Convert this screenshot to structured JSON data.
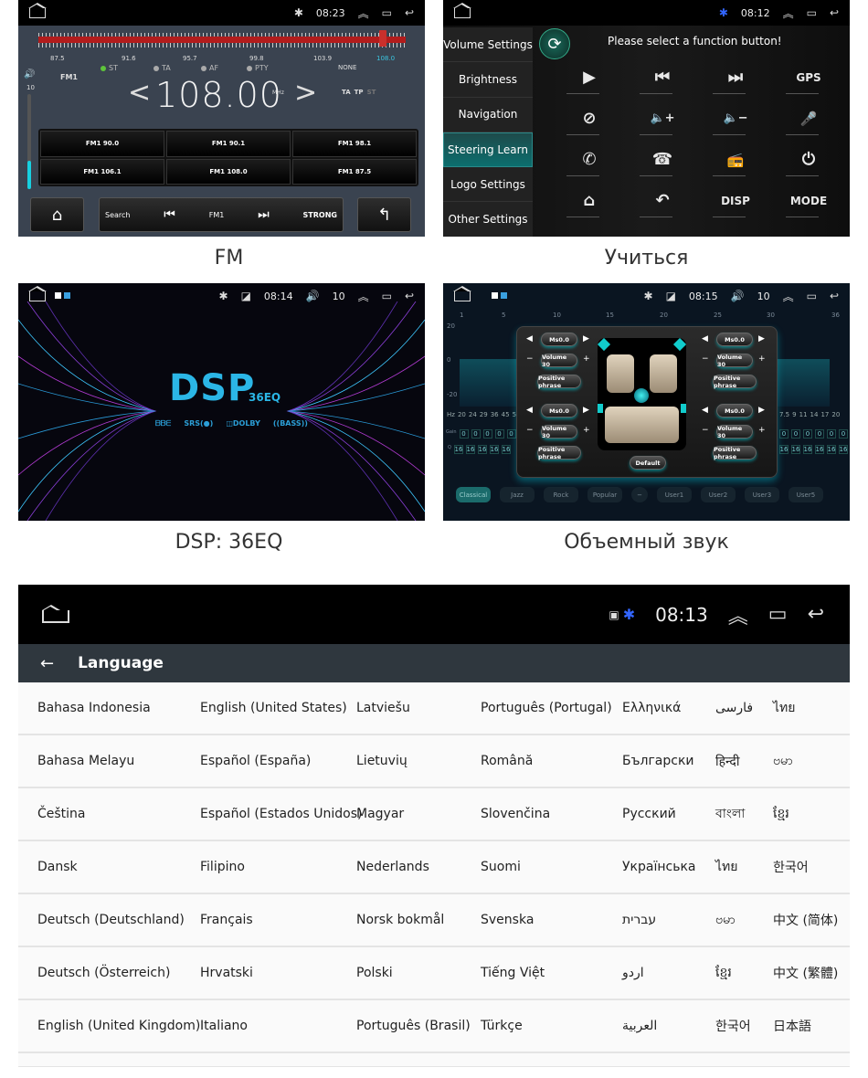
{
  "captions": {
    "fm": "FM",
    "steering": "Учиться",
    "dsp": "DSP: 36EQ",
    "surround": "Объемный звук"
  },
  "fm_screen": {
    "status": {
      "time": "08:23"
    },
    "scale_labels": [
      "87.5",
      "91.6",
      "95.7",
      "99.8",
      "103.9",
      "108.0"
    ],
    "indicators": [
      {
        "label": "ST",
        "on": true
      },
      {
        "label": "TA",
        "on": false
      },
      {
        "label": "AF",
        "on": false
      },
      {
        "label": "PTY",
        "on": false
      }
    ],
    "pty_value": "NONE",
    "band": "FM1",
    "frequency": "108.00",
    "unit": "MHz",
    "flags": [
      "TA",
      "TP",
      "ST"
    ],
    "volume": "10",
    "volume_level_fraction": 0.3,
    "presets": [
      "FM1 90.0",
      "FM1 90.1",
      "FM1 98.1",
      "FM1 106.1",
      "FM1 108.0",
      "FM1 87.5"
    ],
    "controls": {
      "search": "Search",
      "band": "FM1",
      "signal": "STRONG"
    }
  },
  "steering_screen": {
    "status": {
      "time": "08:12"
    },
    "menu": [
      "Volume Settings",
      "Brightness",
      "Navigation",
      "Steering Learn",
      "Logo Settings",
      "Other Settings"
    ],
    "active_menu": "Steering Learn",
    "prompt": "Please select a function button!",
    "functions": [
      {
        "name": "play",
        "glyph": "▶"
      },
      {
        "name": "previous",
        "glyph": "⏮"
      },
      {
        "name": "next",
        "glyph": "⏭"
      },
      {
        "name": "gps",
        "glyph": "GPS"
      },
      {
        "name": "mute",
        "glyph": "⊘"
      },
      {
        "name": "volume-up",
        "glyph": "🔈+"
      },
      {
        "name": "volume-down",
        "glyph": "🔈−"
      },
      {
        "name": "microphone",
        "glyph": "🎤"
      },
      {
        "name": "phone",
        "glyph": "✆"
      },
      {
        "name": "hang-up",
        "glyph": "☎"
      },
      {
        "name": "radio",
        "glyph": "📻"
      },
      {
        "name": "power",
        "glyph": "⏻"
      },
      {
        "name": "home",
        "glyph": "⌂"
      },
      {
        "name": "back",
        "glyph": "↶"
      },
      {
        "name": "disp",
        "glyph": "DISP"
      },
      {
        "name": "mode",
        "glyph": "MODE"
      }
    ]
  },
  "dsp_screen": {
    "status": {
      "time": "08:14",
      "volume": "10"
    },
    "title": "DSP",
    "subtitle": "36EQ",
    "logos": [
      "ᗷᗷᗴ",
      "SRS(●)",
      "◫DOLBY",
      "((BASS))"
    ]
  },
  "surround_screen": {
    "status": {
      "time": "08:15",
      "volume": "10"
    },
    "band_numbers": [
      "1",
      "5",
      "10",
      "15",
      "20",
      "25",
      "30",
      "36"
    ],
    "db_labels": [
      "20",
      "0",
      "-20"
    ],
    "hz_left": [
      "Hz",
      "20",
      "24",
      "29",
      "36",
      "45",
      "53"
    ],
    "hz_right": [
      "7.5",
      "9",
      "11",
      "14",
      "17",
      "20"
    ],
    "gain_label": "Gain",
    "q_label": "Q",
    "gain_value": "0",
    "q_value": "16",
    "speakers": [
      {
        "delay": "Ms0.0",
        "volume": "Volume 30",
        "phase": "Positive phrase"
      },
      {
        "delay": "Ms0.0",
        "volume": "Volume 30",
        "phase": "Positive phrase"
      },
      {
        "delay": "Ms0.0",
        "volume": "Volume 30",
        "phase": "Positive phrase"
      },
      {
        "delay": "Ms0.0",
        "volume": "Volume 30",
        "phase": "Positive phrase"
      }
    ],
    "default_label": "Default",
    "presets": [
      "Classical",
      "Jazz",
      "Rock",
      "Popular",
      "−",
      "User1",
      "User2",
      "User3",
      "User5"
    ],
    "active_preset": "Classical"
  },
  "language_screen": {
    "status": {
      "time": "08:13"
    },
    "title": "Language",
    "rows": [
      [
        "Bahasa Indonesia",
        "English (United States)",
        "Latviešu",
        "Português (Portugal)",
        "Ελληνικά",
        "فارسی",
        "ไทย"
      ],
      [
        "Bahasa Melayu",
        "Español (España)",
        "Lietuvių",
        "Română",
        "Български",
        "हिन्दी",
        "ဗမာ"
      ],
      [
        "Čeština",
        "Español (Estados Unidos)",
        "Magyar",
        "Slovenčina",
        "Русский",
        "বাংলা",
        "ខ្មែរ"
      ],
      [
        "Dansk",
        "Filipino",
        "Nederlands",
        "Suomi",
        "Українська",
        "ไทย",
        "한국어"
      ],
      [
        "Deutsch (Deutschland)",
        "Français",
        "Norsk bokmål",
        "Svenska",
        "עברית",
        "ဗမာ",
        "中文 (简体)"
      ],
      [
        "Deutsch (Österreich)",
        "Hrvatski",
        "Polski",
        "Tiếng Việt",
        "اردو",
        "ខ្មែរ",
        "中文 (繁體)"
      ],
      [
        "English (United Kingdom)",
        "Italiano",
        "Português (Brasil)",
        "Türkçe",
        "العربية",
        "한국어",
        "日本語"
      ]
    ]
  },
  "colors": {
    "accent_cyan": "#17d0e0",
    "fm_red": "#b21c1c",
    "dsp_blue": "#2bb6e6",
    "lang_header": "#2f373e"
  }
}
